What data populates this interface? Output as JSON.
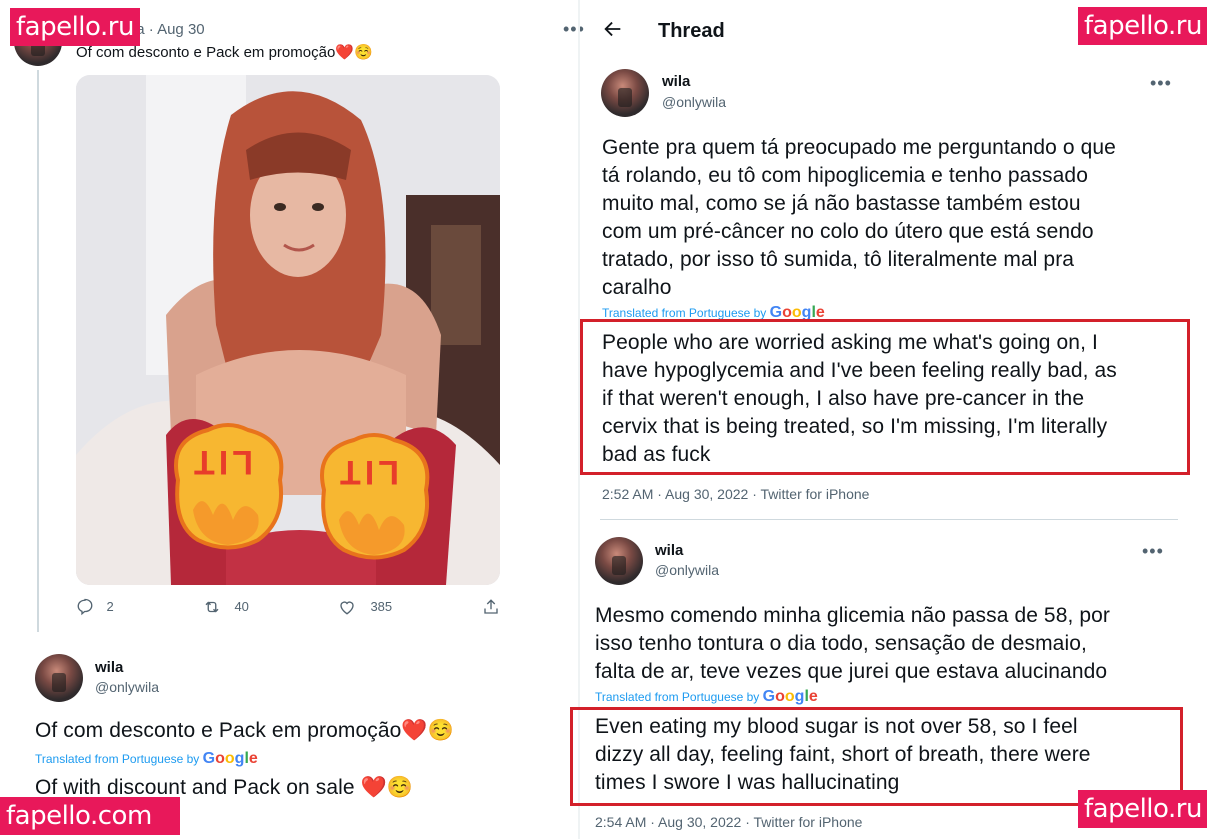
{
  "watermarks": [
    "fapello.ru",
    "fapello.ru",
    "fapello.ru",
    "fapello.com"
  ],
  "left_tweet": {
    "handle_date": "@onlywila · Aug 30",
    "text": "Of com desconto e Pack em promoção",
    "emojis": "❤️☺️",
    "sticker_text": "LIT",
    "actions": {
      "replies": "2",
      "retweets": "40",
      "likes": "385"
    }
  },
  "left_detail": {
    "name": "wila",
    "handle": "@onlywila",
    "text": "Of com desconto e Pack em promoção",
    "emojis": "❤️☺️",
    "translated_label": "Translated from Portuguese by",
    "google": [
      "G",
      "o",
      "o",
      "g",
      "l",
      "e"
    ],
    "translation": "Of with discount and Pack on sale",
    "translation_emojis": "❤️☺️"
  },
  "right_header": {
    "title": "Thread"
  },
  "thread_tweet_1": {
    "name": "wila",
    "handle": "@onlywila",
    "lines": [
      "Gente pra quem tá preocupado me perguntando o que",
      "tá rolando, eu tô com hipoglicemia e tenho passado",
      "muito mal, como se já não bastasse também estou",
      "com um pré-câncer no colo do útero que está sendo",
      "tratado, por isso tô sumida, tô literalmente mal pra",
      "caralho"
    ],
    "translated_label": "Translated from Portuguese by",
    "translation_lines": [
      "People who are worried asking me what's going on, I",
      "have hypoglycemia and I've been feeling really bad, as",
      "if that weren't enough, I also have pre-cancer in the",
      "cervix that is being treated, so I'm missing, I'm literally",
      "bad as fuck"
    ],
    "meta": "2:52 AM · Aug 30, 2022 · Twitter for iPhone"
  },
  "thread_tweet_2": {
    "name": "wila",
    "handle": "@onlywila",
    "lines": [
      "Mesmo comendo minha glicemia não passa de 58, por",
      "isso tenho tontura o dia todo, sensação de desmaio,",
      "falta de ar, teve vezes que jurei que estava alucinando"
    ],
    "translated_label": "Translated from Portuguese by",
    "translation_lines": [
      "Even eating my blood sugar is not over 58, so I feel",
      "dizzy all day, feeling faint, short of breath, there were",
      "times I swore I was hallucinating"
    ],
    "meta": "2:54 AM · Aug 30, 2022 · Twitter for iPhone"
  },
  "colors": {
    "accent": "#1d9bf0",
    "highlight_box": "#d3202a",
    "watermark": "#e8185a"
  }
}
